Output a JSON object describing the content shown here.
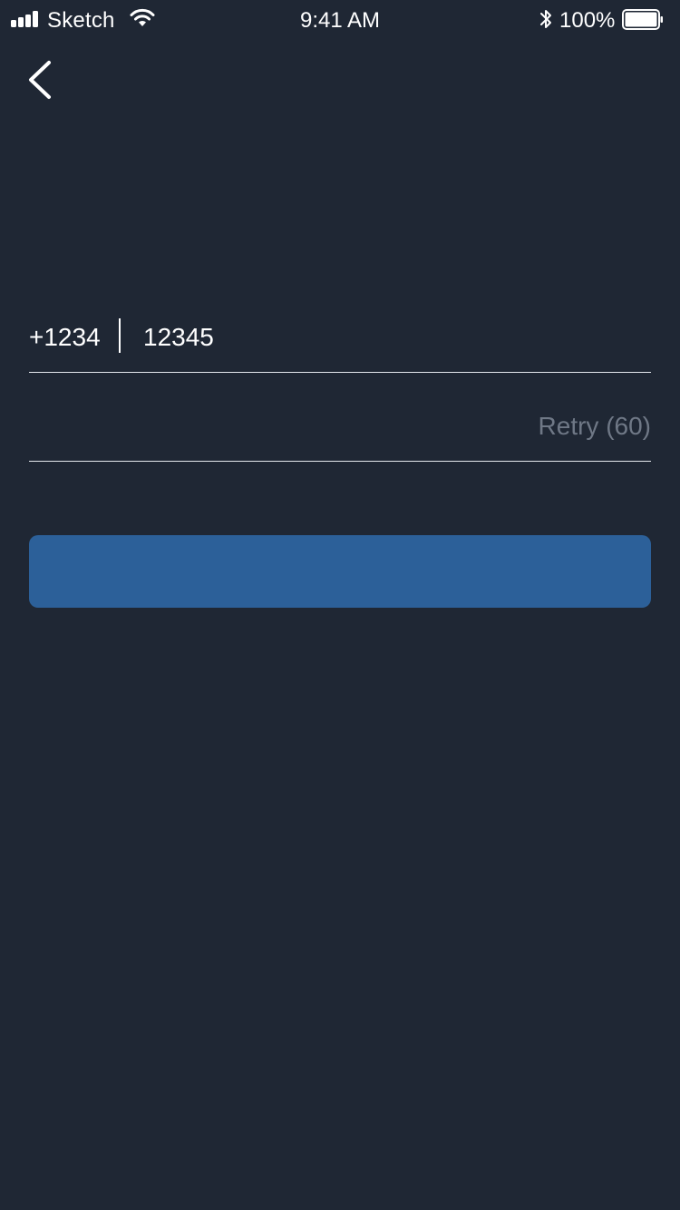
{
  "status_bar": {
    "carrier": "Sketch",
    "time": "9:41 AM",
    "battery_percent": "100%",
    "battery_level": 1.0,
    "icons": [
      "signal-icon",
      "wifi-icon",
      "bluetooth-icon",
      "battery-icon"
    ]
  },
  "nav": {
    "back_icon": "chevron-left-icon"
  },
  "phone": {
    "country_code": "+1234",
    "number": "12345"
  },
  "verification": {
    "code_value": "",
    "retry_label": "Retry (60)"
  },
  "submit": {
    "label": ""
  },
  "colors": {
    "background": "#1f2734",
    "primary": "#2c6099",
    "text": "#ffffff",
    "muted_text": "#6f7886",
    "divider": "#e6e9ee"
  }
}
